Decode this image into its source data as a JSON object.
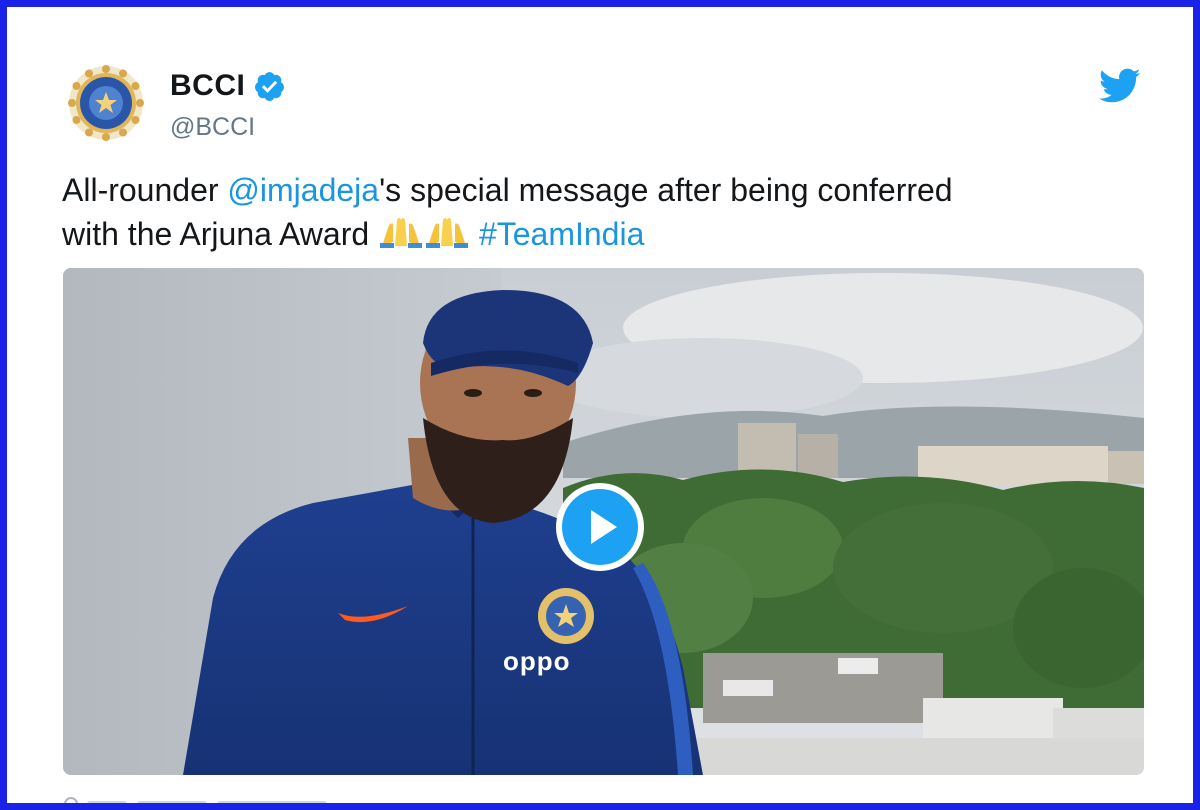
{
  "account": {
    "display_name": "BCCI",
    "handle": "@BCCI",
    "verified": true
  },
  "tweet": {
    "text_part1": "All-rounder ",
    "mention": "@imjadeja",
    "text_part2": "'s special message after being conferred",
    "text_part3": "with the Arjuna Award ",
    "hashtag": "#TeamIndia"
  },
  "media": {
    "type": "video",
    "jersey_sponsor": "oppo"
  },
  "icons": {
    "brand": "twitter-bird-icon",
    "verified": "verified-badge-icon",
    "emoji": "folded-hands-emoji",
    "play": "play-icon"
  },
  "colors": {
    "frame_border": "#1a22e8",
    "link": "#1b95e0",
    "twitter_blue": "#1da1f2",
    "text": "#14171a",
    "muted": "#657786"
  }
}
